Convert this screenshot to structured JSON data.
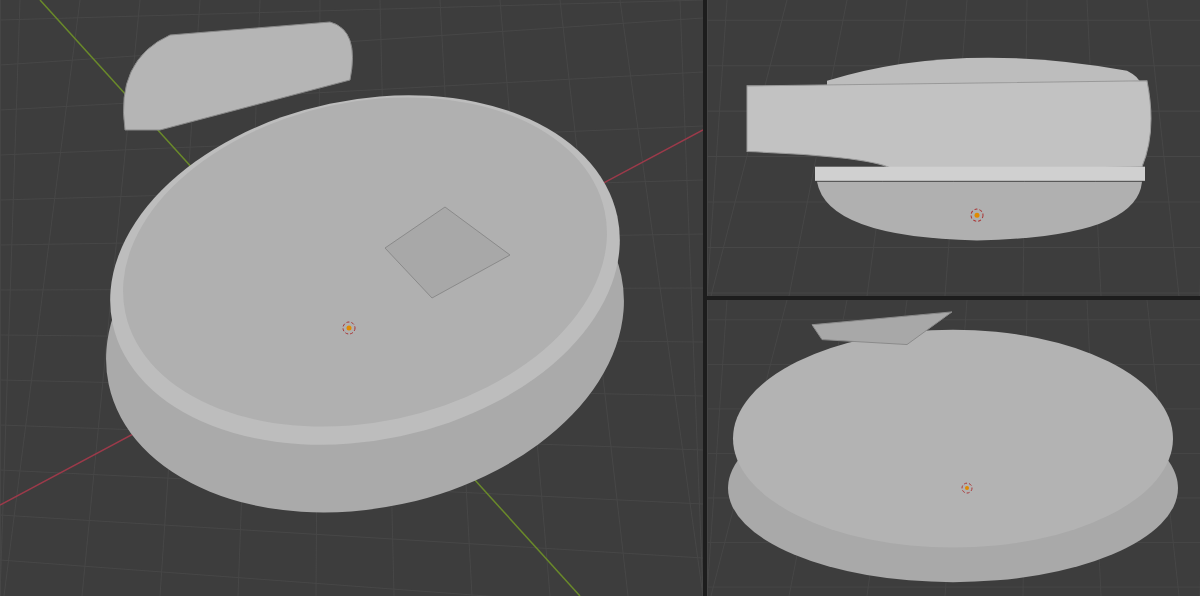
{
  "viewports": [
    {
      "kind": "perspective"
    },
    {
      "kind": "side"
    },
    {
      "kind": "closeup"
    }
  ]
}
